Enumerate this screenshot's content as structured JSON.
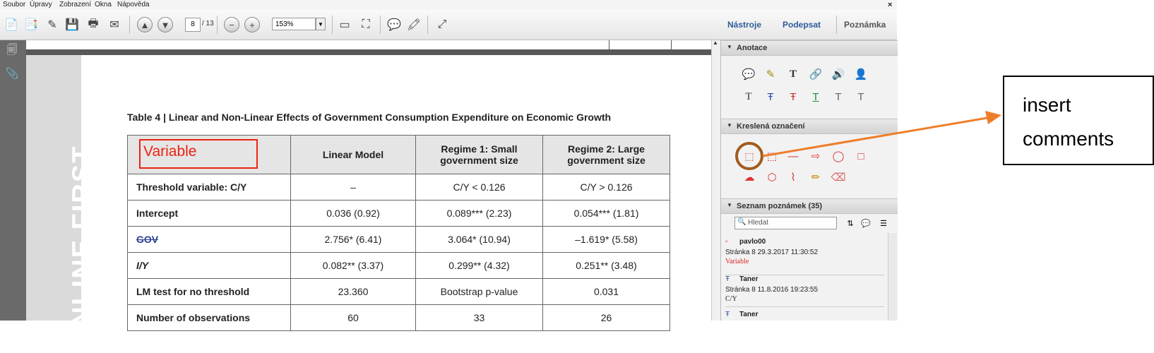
{
  "menu": {
    "items": [
      "Soubor",
      "Úpravy",
      "Zobrazení",
      "Okna",
      "Nápověda"
    ],
    "close": "×"
  },
  "toolbar": {
    "page_current": "8",
    "page_total": "/ 13",
    "zoom": "153%",
    "links": [
      "Nástroje",
      "Podepsat",
      "Poznámka"
    ]
  },
  "document": {
    "side_text": "ONLINE FIRST",
    "table_title": "Table 4 | Linear and Non-Linear Effects of Government Consumption Expenditure on Economic Growth",
    "annotation_box_text": "Variable",
    "columns": [
      "Variable",
      "Linear Model",
      "Regime 1: Small government size",
      "Regime 2: Large government size"
    ],
    "rows": [
      {
        "label": "Threshold variable: C/Y",
        "cells": [
          "–",
          "C/Y < 0.126",
          "C/Y > 0.126"
        ]
      },
      {
        "label": "Intercept",
        "cells": [
          "0.036 (0.92)",
          "0.089*** (2.23)",
          "0.054*** (1.81)"
        ]
      },
      {
        "label": "GOV",
        "cells": [
          "2.756* (6.41)",
          "3.064* (10.94)",
          "–1.619* (5.58)"
        ]
      },
      {
        "label": "I/Y",
        "cells": [
          "0.082** (3.37)",
          "0.299** (4.32)",
          "0.251** (3.48)"
        ]
      },
      {
        "label": "LM test for no threshold",
        "cells": [
          "23.360",
          "Bootstrap p-value",
          "0.031"
        ]
      },
      {
        "label": "Number of observations",
        "cells": [
          "60",
          "33",
          "26"
        ]
      }
    ]
  },
  "rpane": {
    "section_annotations": "Anotace",
    "section_drawing": "Kreslená označení",
    "section_list": "Seznam poznámek (35)",
    "search_placeholder": "Hledat",
    "notes": [
      {
        "author": "pavlo00",
        "when": "Stránka 8  29.3.2017 11:30:52",
        "text": "Variable"
      },
      {
        "author": "Taner",
        "when": "Stránka 8  11.8.2016 19:23:55",
        "text": "C/Y"
      },
      {
        "author": "Taner",
        "when": "",
        "text": ""
      }
    ]
  },
  "callout": {
    "line1": "insert",
    "line2": "comments"
  }
}
